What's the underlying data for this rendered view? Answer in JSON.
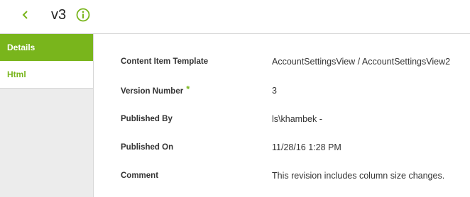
{
  "header": {
    "back_icon": "chevron-left-icon",
    "title": "v3",
    "info_icon": "info-circle-icon"
  },
  "sidebar": {
    "tabs": [
      {
        "label": "Details",
        "active": true
      },
      {
        "label": "Html",
        "active": false
      }
    ]
  },
  "details": {
    "fields": [
      {
        "label": "Content Item Template",
        "value": "AccountSettingsView / AccountSettingsView2",
        "required": false
      },
      {
        "label": "Version Number",
        "value": "3",
        "required": true,
        "required_marker": "*"
      },
      {
        "label": "Published By",
        "value": "ls\\khambek -",
        "required": false
      },
      {
        "label": "Published On",
        "value": "11/28/16 1:28 PM",
        "required": false
      },
      {
        "label": "Comment",
        "value": "This revision includes column size changes.",
        "required": false
      }
    ]
  },
  "colors": {
    "accent": "#79b51c",
    "sidebar_bg": "#ececec",
    "border": "#d6d6d6",
    "text": "#333333"
  }
}
